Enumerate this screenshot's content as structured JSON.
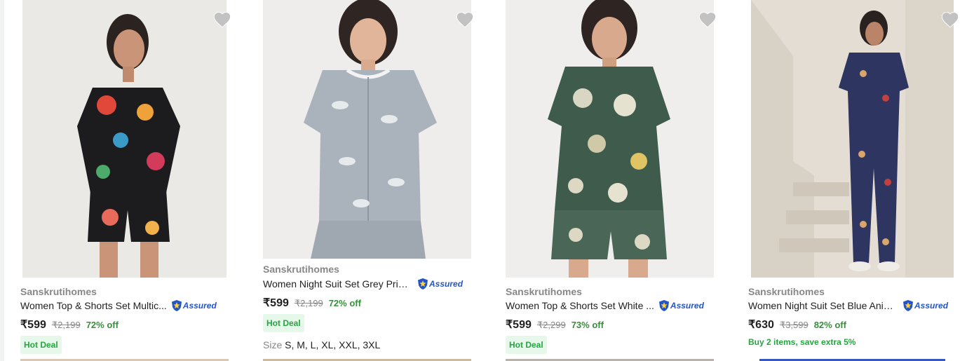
{
  "currency_symbol": "₹",
  "assured_label": "Assured",
  "size_label": "Size",
  "colors": {
    "accent_green": "#388e3c",
    "badge_green": "#26a541",
    "badge_bg": "#e6f8ea",
    "assured_blue": "#2455c8",
    "wishlist_grey": "#c2c2c2"
  },
  "products": [
    {
      "brand": "Sanskrutihomes",
      "title": "Women Top & Shorts Set Multic...",
      "price": "₹599",
      "mrp": "₹2,199",
      "discount": "72% off",
      "badge": "Hot Deal",
      "icon": "heart-icon"
    },
    {
      "brand": "Sanskrutihomes",
      "title": "Women Night Suit Set Grey Print...",
      "price": "₹599",
      "mrp": "₹2,199",
      "discount": "72% off",
      "badge": "Hot Deal",
      "sizes": "S, M, L, XL, XXL, 3XL",
      "icon": "heart-icon"
    },
    {
      "brand": "Sanskrutihomes",
      "title": "Women Top & Shorts Set White ...",
      "price": "₹599",
      "mrp": "₹2,299",
      "discount": "73% off",
      "badge": "Hot Deal",
      "icon": "heart-icon"
    },
    {
      "brand": "Sanskrutihomes",
      "title": "Women Night Suit Set Blue Anim...",
      "price": "₹630",
      "mrp": "₹3,599",
      "discount": "82% off",
      "offer": "Buy 2 items, save extra 5%",
      "icon": "heart-icon"
    }
  ]
}
